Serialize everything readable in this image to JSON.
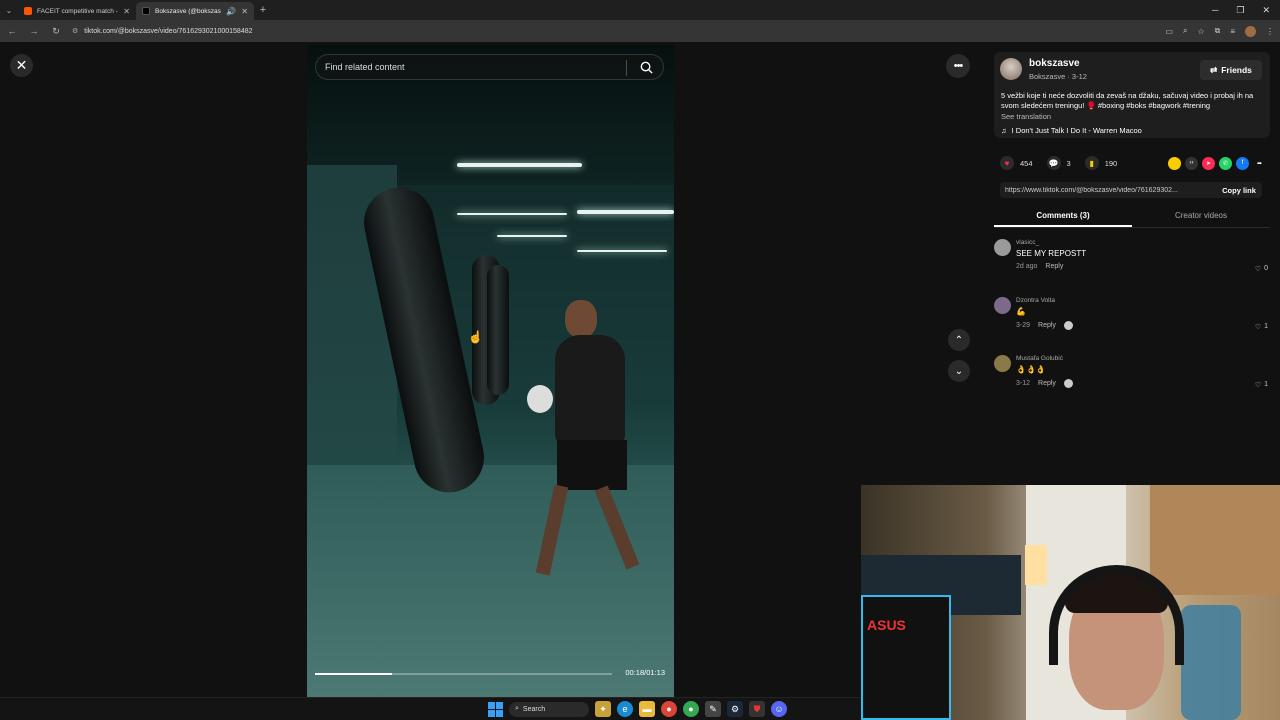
{
  "browser": {
    "tabs": [
      {
        "title": "FACEIT competitive match - FA",
        "favicon_color": "#ff5500",
        "active": false
      },
      {
        "title": "Bokszasve (@bokszasve) | Ti",
        "favicon_color": "#111111",
        "active": true
      }
    ],
    "url": "tiktok.com/@bokszasve/video/7616293021000158482",
    "new_tab": "+"
  },
  "video": {
    "search_placeholder": "Find related content",
    "time": "00:18/01:13",
    "progress": 0.26
  },
  "post": {
    "author": "bokszasve",
    "author_sub": "Bokszasve · 3-12",
    "friends_label": "Friends",
    "caption": "5 vežbi koje ti neće dozvoliti da zevaš na džaku, sačuvaj video i probaj ih na svom sledećem treningu! 🥊 #boxing #boks #bagwork #trening",
    "see_translation": "See translation",
    "music": "I Don't Just Talk I Do It - Warren Macoo",
    "likes": "454",
    "comments_count": "3",
    "saves": "190",
    "link": "https://www.tiktok.com/@bokszasve/video/761629302...",
    "copy_link": "Copy link"
  },
  "tabs": {
    "comments": "Comments (3)",
    "creator_videos": "Creator videos"
  },
  "comments": [
    {
      "user": "vlasicc_",
      "text": "SEE MY REPOSTT",
      "date": "2d ago",
      "reply": "Reply",
      "likes": "0",
      "avatar_color": "#9a9a9a",
      "creator_liked": false
    },
    {
      "user": "Dzontra Volta",
      "text": "💪",
      "date": "3-29",
      "reply": "Reply",
      "likes": "1",
      "avatar_color": "#7d6a8a",
      "creator_liked": true
    },
    {
      "user": "Mustafa Golubić",
      "text": "👌👌👌",
      "date": "3-12",
      "reply": "Reply",
      "likes": "1",
      "avatar_color": "#8a7a4a",
      "creator_liked": true
    }
  ],
  "taskbar": {
    "search_label": "Search"
  },
  "colors": {
    "like_red": "#fe2c55",
    "save_yellow": "#facd00"
  }
}
